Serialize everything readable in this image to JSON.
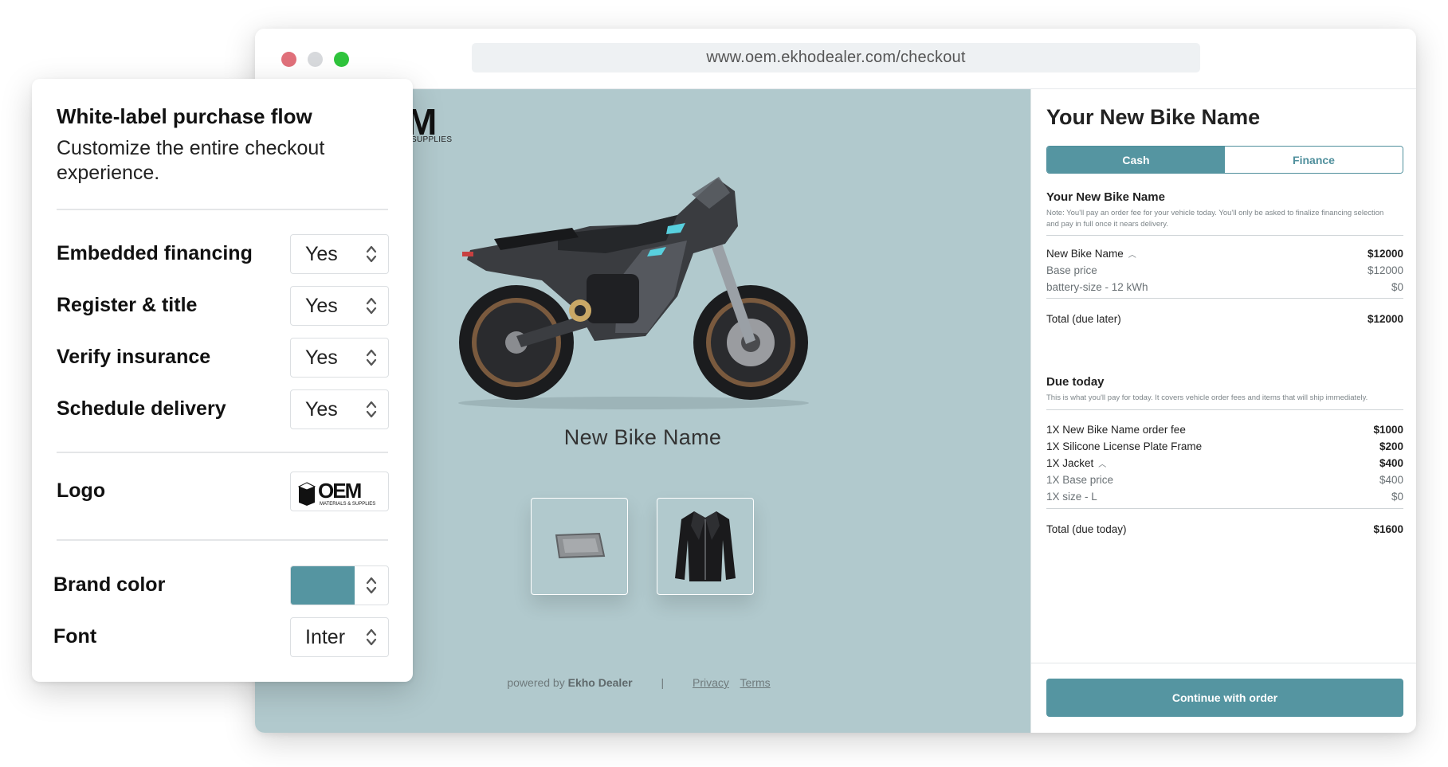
{
  "browser": {
    "url": "www.oem.ekhodealer.com/checkout"
  },
  "hero": {
    "logo_text": "M",
    "logo_sub": "SUPPLIES",
    "bike_name": "New Bike Name",
    "thumbnails": [
      {
        "icon": "license-plate-frame-icon"
      },
      {
        "icon": "leather-jacket-icon"
      }
    ],
    "footer": {
      "powered_prefix": "powered by",
      "powered_brand": "Ekho Dealer",
      "separator": "|",
      "privacy": "Privacy",
      "terms": "Terms"
    }
  },
  "panel": {
    "title": "Your New Bike Name",
    "tabs": {
      "cash": "Cash",
      "finance": "Finance"
    },
    "vehicle_section": {
      "title": "Your New Bike Name",
      "note": "Note: You'll pay an order fee for your vehicle today. You'll only be asked to finalize financing selection and pay in full once it nears delivery.",
      "item_name": "New Bike Name",
      "item_amount": "$12000",
      "base_label": "Base price",
      "base_amount": "$12000",
      "battery_label": "battery-size - 12 kWh",
      "battery_amount": "$0",
      "total_label": "Total (due later)",
      "total_amount": "$12000"
    },
    "today_section": {
      "title": "Due today",
      "note": "This is what you'll pay for today. It covers vehicle order fees and items that will ship immediately.",
      "order_fee_label": "1X New Bike Name order fee",
      "order_fee_amount": "$1000",
      "frame_label": "1X Silicone License Plate Frame",
      "frame_amount": "$200",
      "jacket_label": "1X Jacket",
      "jacket_amount": "$400",
      "jacket_base_label": "1X Base price",
      "jacket_base_amount": "$400",
      "jacket_size_label": "1X size - L",
      "jacket_size_amount": "$0",
      "total_label": "Total (due today)",
      "total_amount": "$1600"
    },
    "cta": "Continue with order"
  },
  "card": {
    "title": "White-label purchase flow",
    "subtitle": "Customize the entire checkout experience.",
    "options": [
      {
        "label": "Embedded financing",
        "value": "Yes"
      },
      {
        "label": "Register & title",
        "value": "Yes"
      },
      {
        "label": "Verify insurance",
        "value": "Yes"
      },
      {
        "label": "Schedule delivery",
        "value": "Yes"
      }
    ],
    "logo_label": "Logo",
    "logo_main": "OEM",
    "logo_sub": "MATERIALS & SUPPLIES",
    "brand_color_label": "Brand color",
    "brand_color": "#5595a1",
    "font_label": "Font",
    "font_value": "Inter"
  }
}
